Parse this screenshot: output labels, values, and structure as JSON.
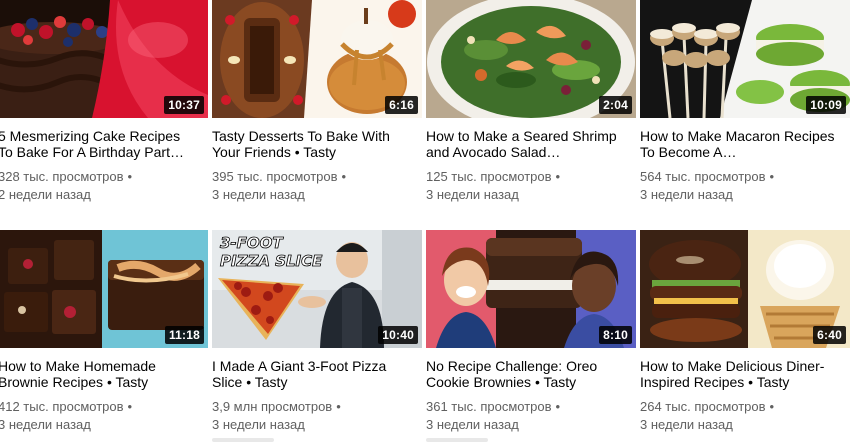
{
  "videos": [
    {
      "title": "5 Mesmerizing Cake Recipes To Bake For A Birthday Part…",
      "views": "328 тыс. просмотров",
      "age": "2 недели назад",
      "duration": "10:37",
      "thumb_icon": "chocolate-cake-thumbnail",
      "colors": [
        "#3a1f14",
        "#d8122f"
      ]
    },
    {
      "title": "Tasty Desserts To Bake With Your Friends • Tasty",
      "views": "395 тыс. просмотров",
      "age": "3 недели назад",
      "duration": "6:16",
      "thumb_icon": "desserts-thumbnail",
      "colors": [
        "#8a4a22",
        "#c67a30"
      ]
    },
    {
      "title": "How to Make a Seared Shrimp and Avocado Salad…",
      "views": "125 тыс. просмотров",
      "age": "3 недели назад",
      "duration": "2:04",
      "thumb_icon": "shrimp-salad-thumbnail",
      "colors": [
        "#3f6f2a",
        "#e98a4c"
      ]
    },
    {
      "title": "How to Make Macaron Recipes To Become A…",
      "views": "564 тыс. просмотров",
      "age": "3 недели назад",
      "duration": "10:09",
      "thumb_icon": "macaron-thumbnail",
      "colors": [
        "#1b1b1b",
        "#7ab83b"
      ]
    },
    {
      "title": "How to Make Homemade Brownie Recipes • Tasty",
      "views": "412 тыс. просмотров",
      "age": "3 недели назад",
      "duration": "11:18",
      "thumb_icon": "brownie-thumbnail",
      "colors": [
        "#2c160c",
        "#6fc4d6"
      ]
    },
    {
      "title": "I Made A Giant 3-Foot Pizza Slice • Tasty",
      "views": "3,9 млн просмотров",
      "age": "3 недели назад",
      "duration": "10:40",
      "thumb_icon": "giant-pizza-thumbnail",
      "overlay_text": "3-FOOT PIZZA SLICE",
      "colors": [
        "#d9dde0",
        "#d2481e"
      ]
    },
    {
      "title": "No Recipe Challenge: Oreo Cookie Brownies • Tasty",
      "views": "361 тыс. просмотров",
      "age": "3 недели назад",
      "duration": "8:10",
      "thumb_icon": "oreo-challenge-thumbnail",
      "colors": [
        "#e25a6c",
        "#2a1811"
      ]
    },
    {
      "title": "How to Make Delicious Diner-Inspired Recipes • Tasty",
      "views": "264 тыс. просмотров",
      "age": "3 недели назад",
      "duration": "6:40",
      "thumb_icon": "diner-burger-thumbnail",
      "colors": [
        "#4a2412",
        "#f3e8c8"
      ]
    }
  ]
}
